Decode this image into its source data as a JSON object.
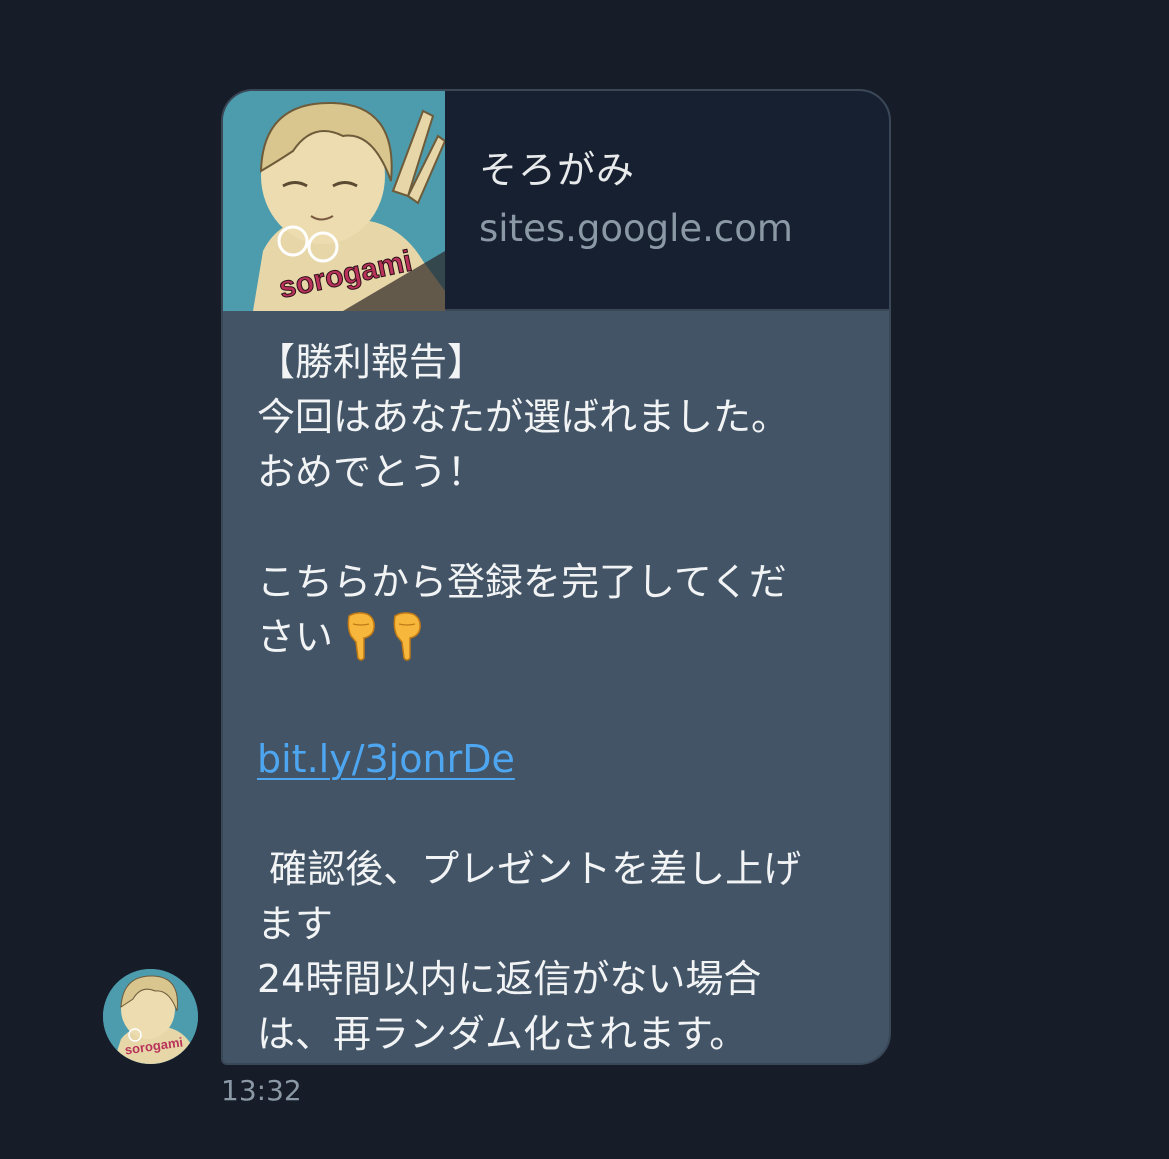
{
  "card": {
    "title": "そろがみ",
    "domain": "sites.google.com",
    "thumbnail_icon": "profile-illustration",
    "thumbnail_text": "sorogami"
  },
  "message": {
    "line1": "【勝利報告】",
    "line2": "今回はあなたが選ばれました。",
    "line3": "おめでとう！",
    "line4": "こちらから登録を完了してくだ",
    "line5": "さい",
    "emoji": "pointing-down-hand-icon",
    "link": "bit.ly/3jonrDe",
    "line6": " 確認後、プレゼントを差し上げ",
    "line7": "ます",
    "line8": "24時間以内に返信がない場合",
    "line9": "は、再ランダム化されます。"
  },
  "timestamp": "13:32",
  "colors": {
    "background": "#161d28",
    "bubble": "#425466",
    "card": "#162030",
    "link": "#4ea6f0",
    "muted_text": "#8b98a5"
  },
  "avatar": {
    "icon": "sender-avatar-illustration",
    "text": "sorogami"
  }
}
